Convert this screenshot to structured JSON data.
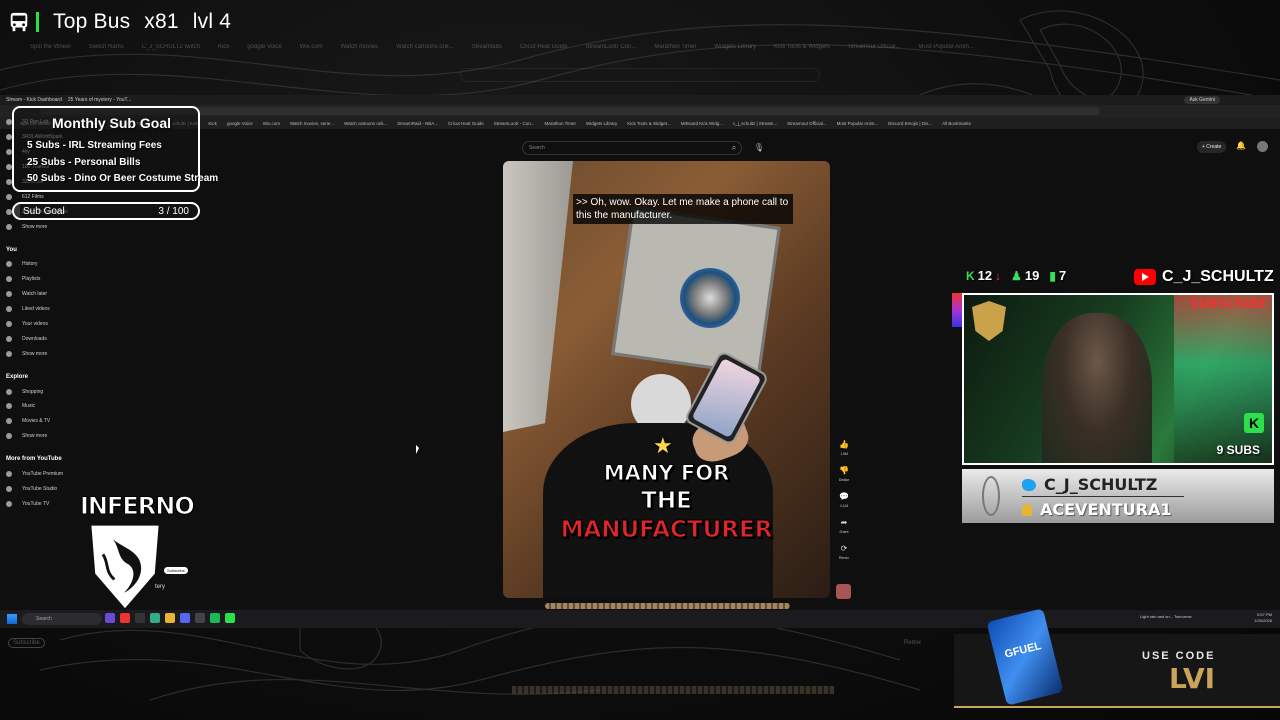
{
  "topbar": {
    "label": "Top Bus",
    "multiplier": "x81",
    "level": "lvl 4"
  },
  "ghost_tabs": [
    "Spin the Wheel",
    "Switch Rams",
    "C_J_SCHULTZ twitch",
    "Kick",
    "google Voice",
    "Wix.com",
    "Watch movies",
    "Watch cartoons onli...",
    "Streamlabs",
    "Cricut Heat Guide",
    "StreamLootr Con...",
    "Marathon Timer",
    "Widgets Library",
    "Kick Tools & Widgets",
    "Streamout Official...",
    "Most Popular Anim..."
  ],
  "browser": {
    "tabs": [
      "Stream - Kick Dashboard",
      "25 Years of mystery - YouT..."
    ],
    "ask": "Ask Gemini",
    "bookmarks": [
      "Spin the Wheel - Ra...",
      "Switch Rams",
      "C_J_SCHULTZ twitch",
      "c_j_schultz | Kick",
      "Kick",
      "google Voice",
      "Wix.com",
      "Watch movies, serie...",
      "Watch cartoons onli...",
      "StreamRaid - NBA...",
      "Cricut Heat Guide",
      "StreamLootr - Con...",
      "Marathon Timer",
      "Widgets Library",
      "Kick Tools & Widget...",
      "MrBoard Kick Widg...",
      "c_j_schultz | Stream...",
      "Streamout Official...",
      "Most Popular Anim...",
      "Discord Emojis | Dis...",
      "All Bookmarks"
    ]
  },
  "yt": {
    "search_placeholder": "Search",
    "create": "+ Create"
  },
  "sidebar": {
    "top": [
      "Home",
      "Shorts"
    ],
    "subs": [
      "3D Pen Lab",
      "3RDLAWofdSpark",
      "4ky",
      "100 Thieves",
      "331Erock",
      "612 Films",
      "A Day To Remember",
      "Show more"
    ],
    "you_header": "You",
    "you": [
      "History",
      "Playlists",
      "Watch later",
      "Liked videos",
      "Your videos",
      "Downloads",
      "Show more"
    ],
    "explore_header": "Explore",
    "explore": [
      "Shopping",
      "Music",
      "Movies & TV",
      "Show more"
    ],
    "more_header": "More from YouTube",
    "more": [
      "YouTube Premium",
      "YouTube Studio",
      "YouTube TV"
    ]
  },
  "video": {
    "caption": ">> Oh, wow. Okay. Let me make a phone call to this the manufacturer.",
    "line1": "MANY FOR",
    "line2": "THE",
    "line3": "MANUFACTURER"
  },
  "actions": [
    {
      "icon": "👍",
      "label": "1.5M"
    },
    {
      "icon": "👎",
      "label": "Dislike"
    },
    {
      "icon": "💬",
      "label": "4,116"
    },
    {
      "icon": "➦",
      "label": "Share"
    },
    {
      "icon": "⟳",
      "label": "Remix"
    }
  ],
  "taskbar": {
    "search": "Search",
    "weather": "Light rain and sn... Tomorrow",
    "time": "5:57 PM",
    "date": "1/30/2026"
  },
  "goal": {
    "title": "Monthly Sub Goal",
    "items": [
      "5 Subs - IRL Streaming Fees",
      "25 Subs - Personal Bills",
      "50 Subs - Dino Or Beer Costume Stream"
    ],
    "bar_label": "Sub Goal",
    "bar_value": "3 / 100",
    "progress": 0.03
  },
  "inferno": {
    "word": "INFERNO",
    "subscribe": "Subscribe",
    "partial": "tery"
  },
  "stats": {
    "kick": "12",
    "a": "19",
    "b": "7"
  },
  "channel": "C_J_SCHULTZ",
  "cam": {
    "sign": "SUBSCRIBE",
    "subs": "9 SUBS"
  },
  "socials": {
    "twitter": "C_J_SCHULTZ",
    "user": "ACEVENTURA1"
  },
  "sponsor": {
    "can": "GFUEL",
    "use": "USE CODE",
    "code": "LVI"
  },
  "ghost": {
    "subscribe": "Subscribe",
    "remix": "Remix"
  },
  "colors": {
    "kick_green": "#2be04a",
    "yt_red": "#ff0000",
    "gold": "#c9a45a",
    "down_red": "#ff4040"
  }
}
